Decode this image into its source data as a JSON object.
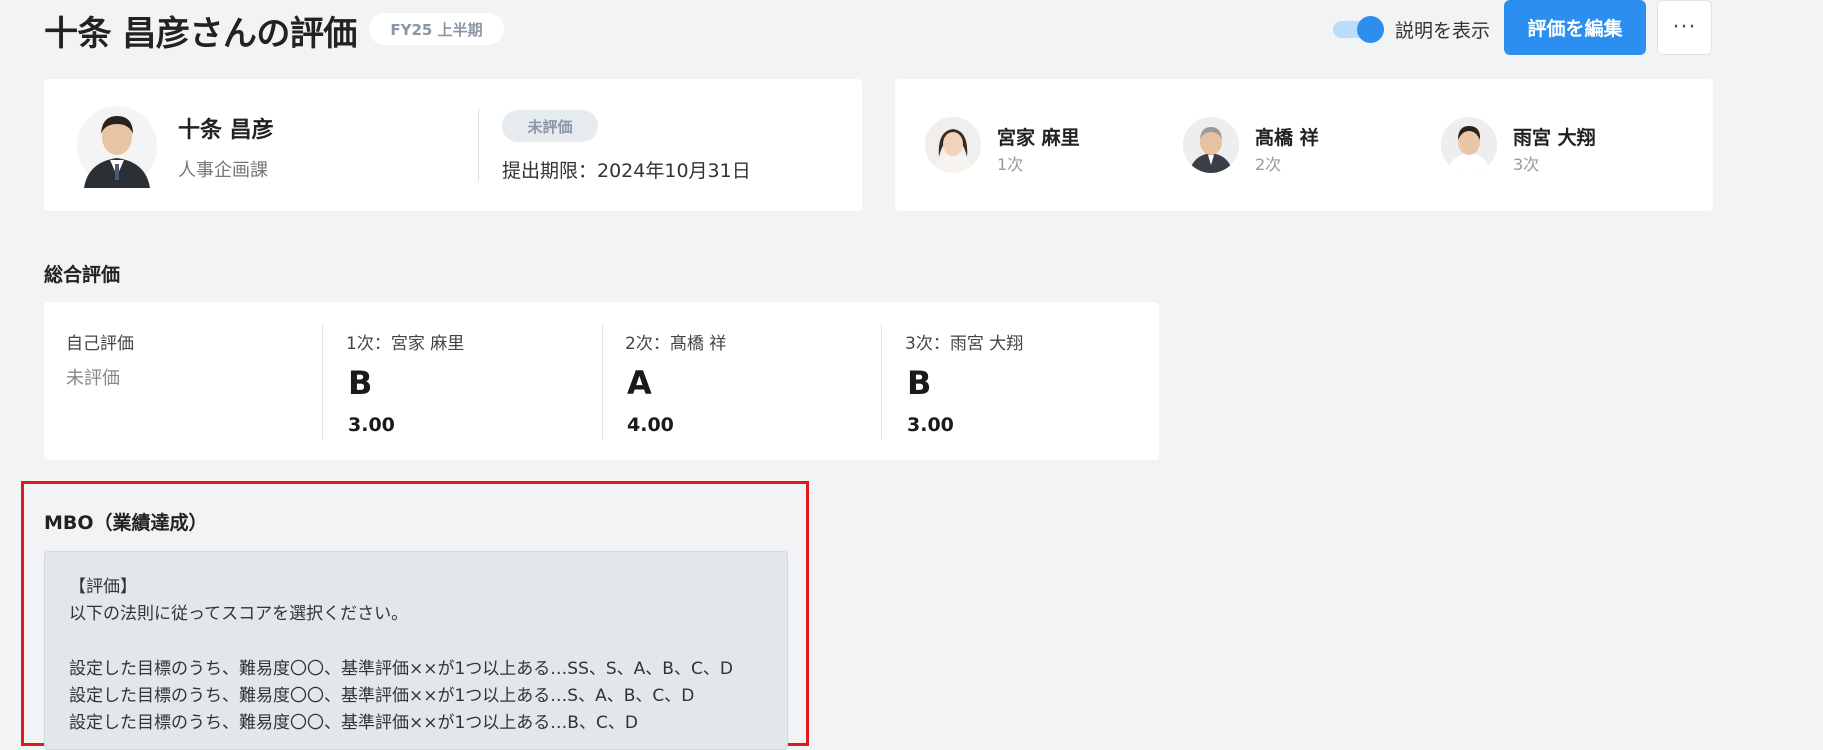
{
  "header": {
    "title": "十条 昌彦さんの評価",
    "period_badge": "FY25 上半期",
    "toggle_label": "説明を表示",
    "toggle_on": true,
    "edit_button": "評価を編集",
    "more_button": "···"
  },
  "employee": {
    "name": "十条 昌彦",
    "department": "人事企画課",
    "status": "未評価",
    "deadline": "提出期限：2024年10月31日"
  },
  "evaluators": [
    {
      "name": "宮家 麻里",
      "level": "1次"
    },
    {
      "name": "髙橋 祥",
      "level": "2次"
    },
    {
      "name": "雨宮 大翔",
      "level": "3次"
    }
  ],
  "overall": {
    "title": "総合評価",
    "self": {
      "label": "自己評価",
      "value": "未評価"
    },
    "columns": [
      {
        "label": "1次：宮家 麻里",
        "grade": "B",
        "score": "3.00"
      },
      {
        "label": "2次：髙橋 祥",
        "grade": "A",
        "score": "4.00"
      },
      {
        "label": "3次：雨宮 大翔",
        "grade": "B",
        "score": "3.00"
      }
    ]
  },
  "mbo": {
    "title": "MBO（業績達成）",
    "lines": [
      "【評価】",
      "以下の法則に従ってスコアを選択ください。",
      "設定した目標のうち、難易度〇〇、基準評価××が1つ以上ある…SS、S、A、B、C、D",
      "設定した目標のうち、難易度〇〇、基準評価××が1つ以上ある…S、A、B、C、D",
      "設定した目標のうち、難易度〇〇、基準評価××が1つ以上ある…B、C、D"
    ]
  },
  "colors": {
    "accent": "#2c8ff0",
    "highlight": "#e01a1a",
    "background": "#f2f3f5"
  }
}
